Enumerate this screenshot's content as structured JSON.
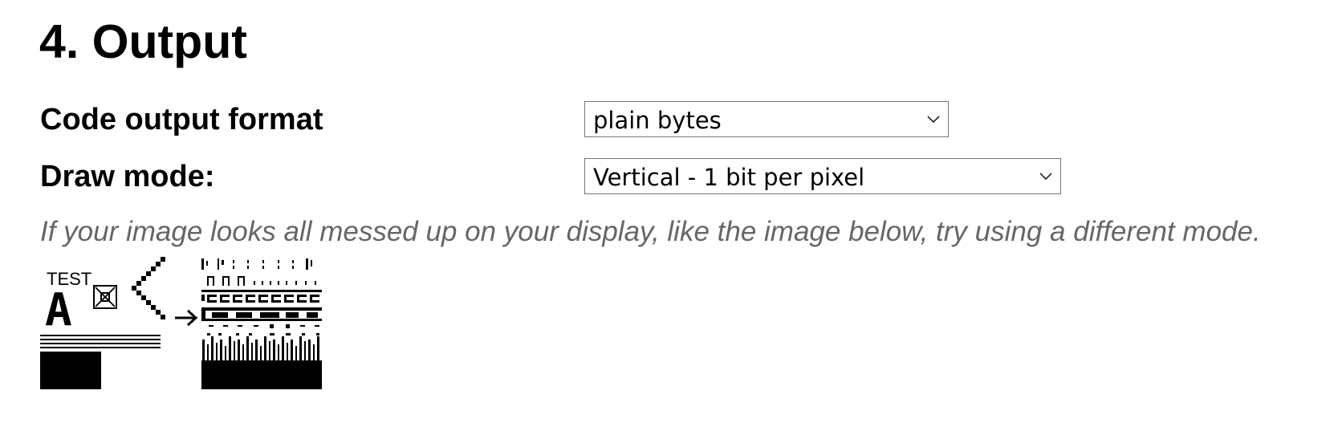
{
  "section": {
    "title": "4. Output"
  },
  "fields": {
    "code_output_format": {
      "label": "Code output format",
      "selected_value": "plain bytes"
    },
    "draw_mode": {
      "label": "Draw mode:",
      "selected_value": "Vertical - 1 bit per pixel"
    }
  },
  "hint": {
    "text": "If your image looks all messed up on your display, like the image below, try using a different mode."
  },
  "example_image": {
    "label_text": "TEST",
    "letter": "A",
    "icons": {
      "dropdown_chevron": "chevron-down-icon",
      "arrow": "right-arrow-icon",
      "boxed_x": "boxed-x-icon",
      "chevron_left": "chevron-left-icon"
    }
  },
  "colors": {
    "text": "#000000",
    "hint_text": "#666666",
    "select_border": "#767676",
    "background": "#ffffff"
  }
}
